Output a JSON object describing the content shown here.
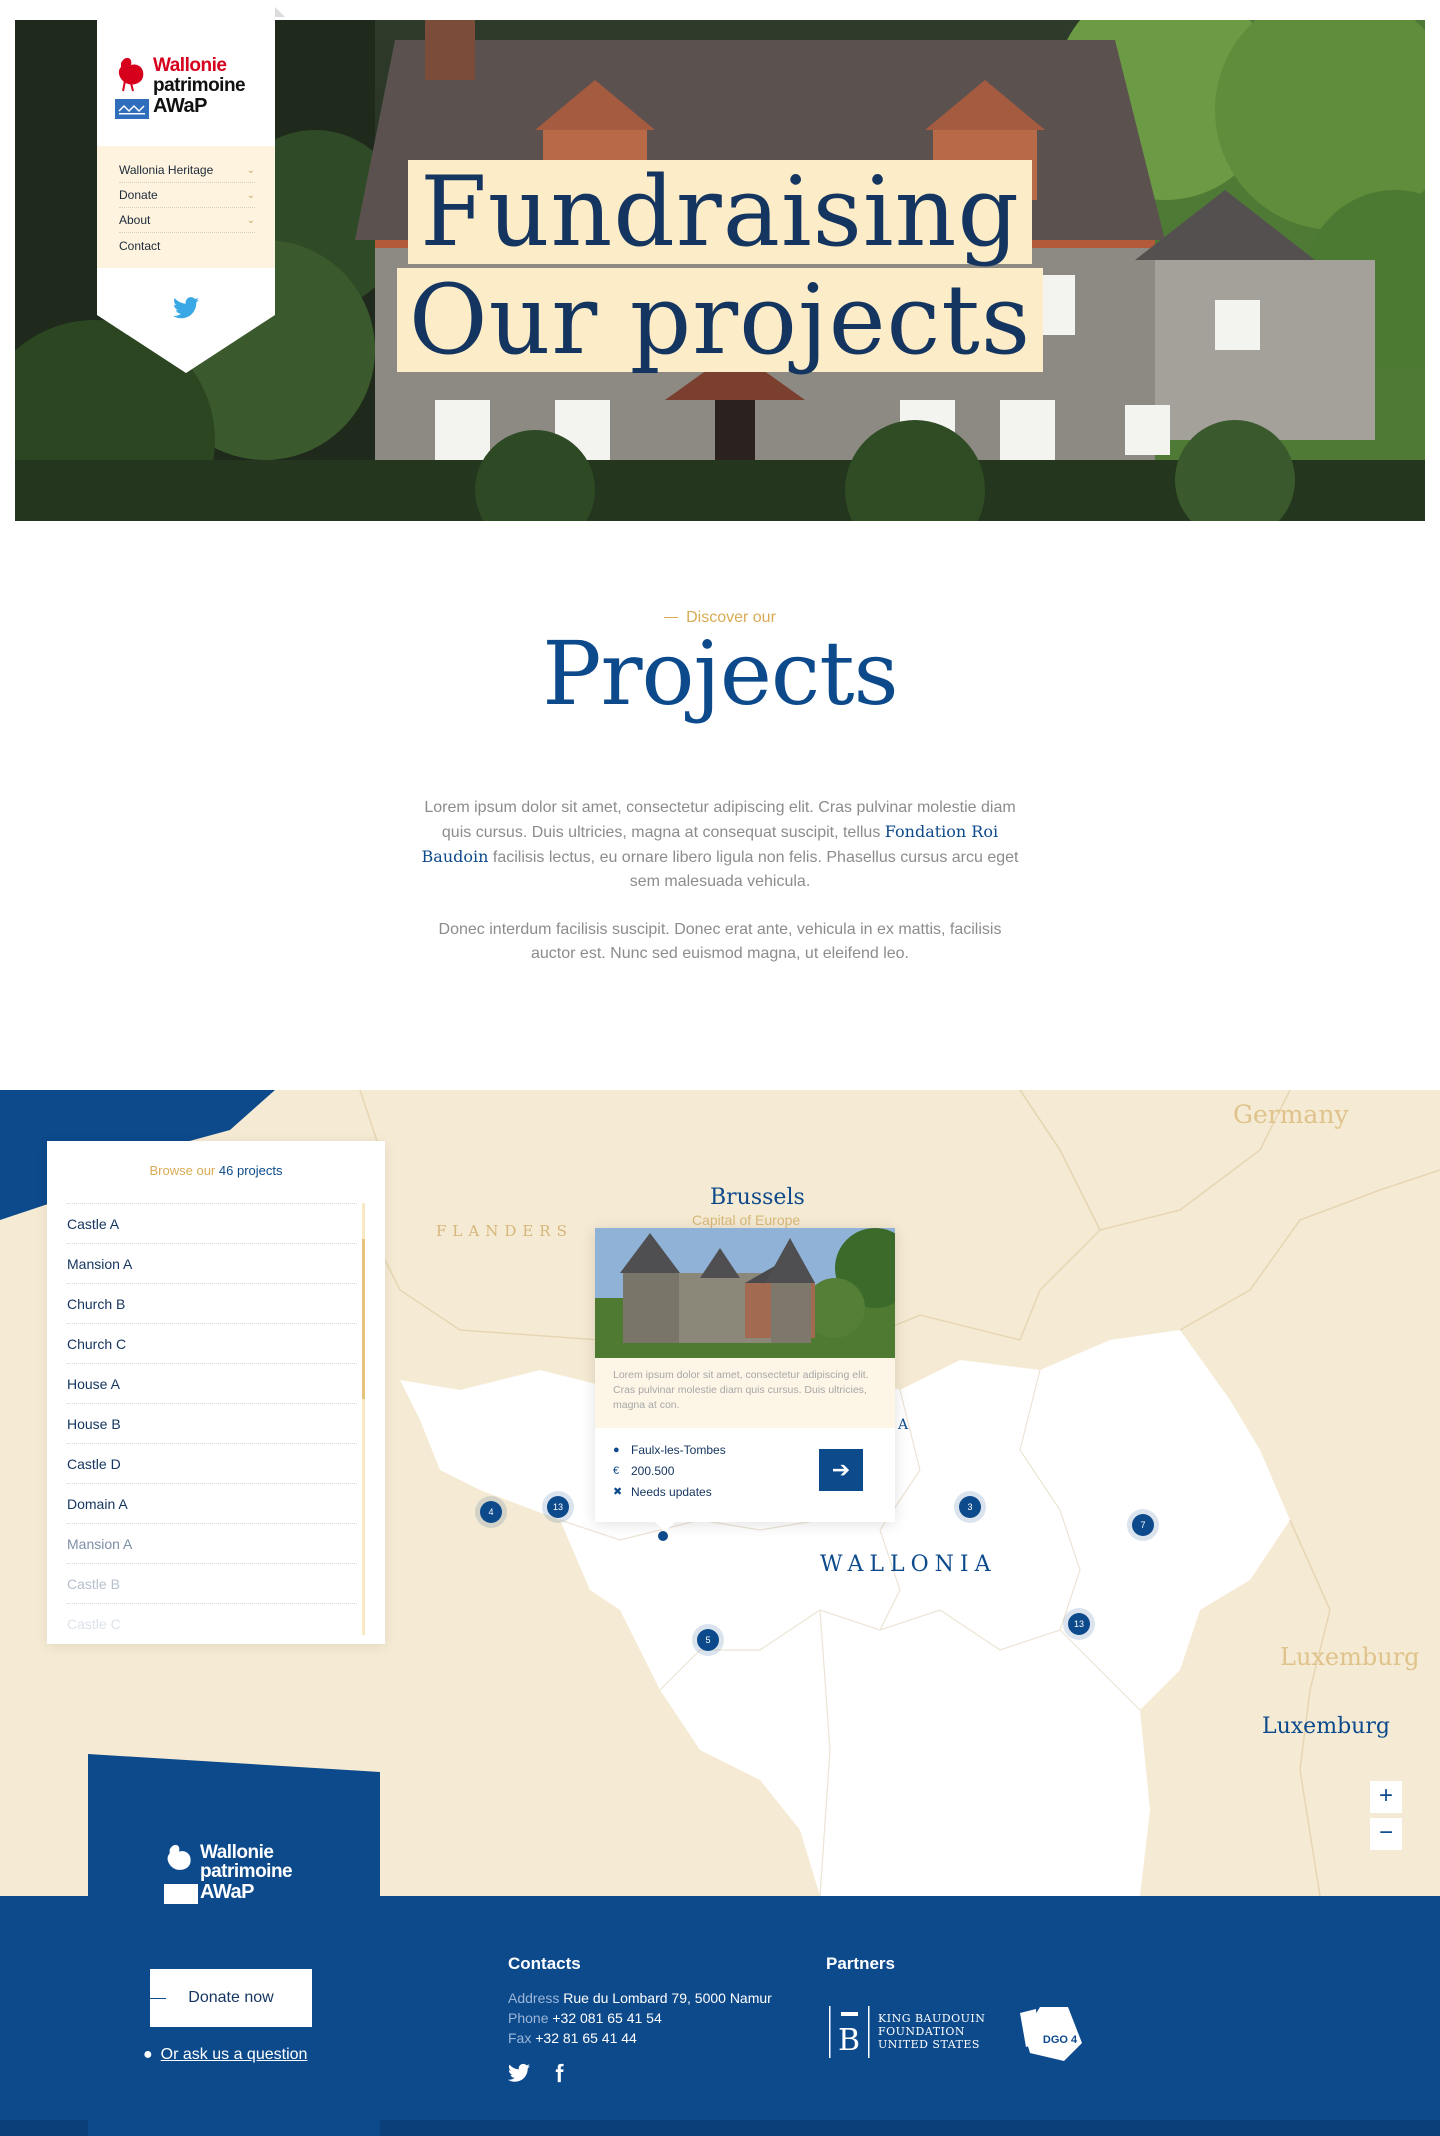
{
  "hero": {
    "title_line1": "Fundraising",
    "title_line2": "Our projects"
  },
  "nav": {
    "logo": {
      "line1": "Wallonie",
      "line2": "patrimoine",
      "line3": "AWaP",
      "brand_red": "#d6001c"
    },
    "items": [
      {
        "label": "Wallonia Heritage",
        "has_dropdown": true
      },
      {
        "label": "Donate",
        "has_dropdown": true
      },
      {
        "label": "About",
        "has_dropdown": true
      },
      {
        "label": "Contact",
        "has_dropdown": false
      }
    ],
    "social_icon": "twitter-icon"
  },
  "intro": {
    "eyebrow": "Discover our",
    "title": "Projects",
    "paragraph1_before": "Lorem ipsum dolor sit amet, consectetur adipiscing elit. Cras pulvinar molestie diam quis cursus. Duis ultricies, magna at consequat suscipit, tellus ",
    "paragraph1_link": "Fondation Roi Baudoin",
    "paragraph1_after": " facilisis lectus, eu ornare libero ligula non felis. Phasellus cursus arcu eget sem malesuada vehicula.",
    "paragraph2": "Donec interdum facilisis suscipit. Donec erat ante, vehicula in ex mattis, facilisis auctor est. Nunc sed euismod magna, ut eleifend leo."
  },
  "map": {
    "labels": {
      "germany": "Germany",
      "brussels": "Brussels",
      "capital": "Capital of Europe",
      "flanders": "FLANDERS",
      "wallonia": "WALLONIA",
      "luxemburg_country": "Luxemburg",
      "luxemburg_province": "Luxemburg"
    },
    "list": {
      "browse_prefix": "Browse our",
      "count_label": "46 projects",
      "items": [
        "Castle A",
        "Mansion A",
        "Church B",
        "Church C",
        "House A",
        "House B",
        "Castle D",
        "Domain A",
        "Mansion A",
        "Castle B",
        "Castle C"
      ]
    },
    "clusters": [
      "4",
      "13",
      "3",
      "7",
      "5",
      "13"
    ],
    "popup": {
      "description": "Lorem ipsum dolor sit amet, consectetur adipiscing elit. Cras pulvinar molestie diam quis cursus. Duis ultricies, magna at con.",
      "location": "Faulx-les-Tombes",
      "amount": "200.500",
      "status": "Needs updates",
      "partial_label": "A"
    },
    "zoom_in": "+",
    "zoom_out": "−"
  },
  "footer": {
    "logo": {
      "line1": "Wallonie",
      "line2": "patrimoine",
      "line3": "AWaP"
    },
    "donate_label": "Donate now",
    "ask_label": "Or ask us a question",
    "contacts": {
      "heading": "Contacts",
      "address_label": "Address",
      "address": "Rue du Lombard 79, 5000 Namur",
      "phone_label": "Phone",
      "phone": "+32 081 65 41 54",
      "fax_label": "Fax",
      "fax": "+32 81 65 41 44"
    },
    "partners": {
      "heading": "Partners",
      "kb_line1": "KING BAUDOUIN",
      "kb_line2": "FOUNDATION",
      "kb_line3": "UNITED STATES",
      "dgo_label": "DGO 4"
    }
  },
  "colors": {
    "navy": "#0d4a8c",
    "gold": "#d9ab55",
    "cream": "#fdecc8",
    "map_bg": "#f5ead3"
  }
}
